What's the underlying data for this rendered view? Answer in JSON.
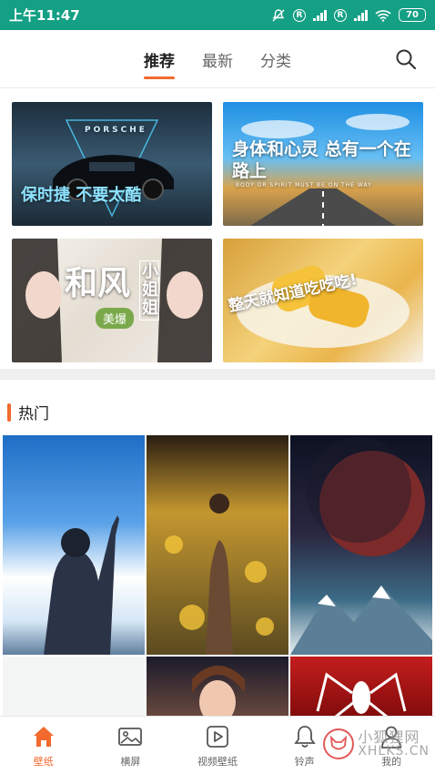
{
  "status_bar": {
    "time": "上午11:47",
    "r1": "R",
    "r2": "R",
    "battery": "70",
    "bg_color": "#14a085"
  },
  "tabs": [
    {
      "label": "推荐",
      "active": true
    },
    {
      "label": "最新",
      "active": false
    },
    {
      "label": "分类",
      "active": false
    }
  ],
  "search_icon": "search-icon",
  "banners": [
    {
      "title": "保时捷 不要太酷",
      "sub": "PORSCHE"
    },
    {
      "title": "身体和心灵 总有一个在路上",
      "sub": "BODY OR SPIRIT MUST BE ON THE WAY"
    },
    {
      "title": "和风",
      "sub": "小姐姐",
      "badge": "美爆"
    },
    {
      "title": "整天就知道吃吃吃!"
    }
  ],
  "section": {
    "title": "热门"
  },
  "accent_color": "#f26a2e",
  "bottom_nav": [
    {
      "label": "壁纸",
      "icon": "home-icon",
      "active": true
    },
    {
      "label": "横屏",
      "icon": "image-icon",
      "active": false
    },
    {
      "label": "视频壁纸",
      "icon": "play-icon",
      "active": false
    },
    {
      "label": "铃声",
      "icon": "bell-icon",
      "active": false
    },
    {
      "label": "我的",
      "icon": "user-icon",
      "active": false
    }
  ],
  "watermark": {
    "line1": "小狐狸网",
    "line2": "XHLKS.CN"
  }
}
